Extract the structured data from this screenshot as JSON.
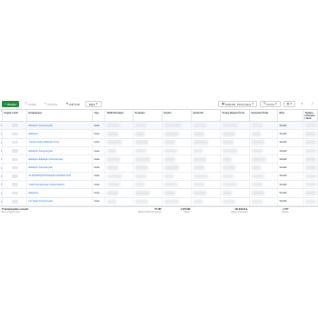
{
  "toolbar": {
    "create_label": "Oluştur",
    "duplicate_label": "Çoğalt",
    "edit_label": "Düzenle",
    "ab_test_label": "A/B Testi",
    "other_label": "Diğer",
    "columns_label": "Sütunlar: Performans",
    "breakdown_label": "Kırılım"
  },
  "columns": {
    "toggle": "Kapalı / Açık",
    "name": "Kampanyas",
    "delivery": "Yayı",
    "bid": "Teklif Stratejisi",
    "results": "Sonuçlar",
    "reach": "Erişim",
    "impressions": "Gösterim",
    "cost_per_result": "Sonuç Başına Ücret",
    "amount_spent": "Harcanan Tutar",
    "ends": "Bitiş",
    "schedule": "Toplam Harcama Limiti",
    "last": "Harcanan Tutar Limiti"
  },
  "rows": [
    {
      "name": "Etkileşim Kampanyası",
      "delivery": "Geta",
      "end": "Sürekli"
    },
    {
      "name": "Etkileşim",
      "delivery": "Geta",
      "end": "Sürekli"
    },
    {
      "name": "Yapılan Satış Etkileşim Kmp.",
      "delivery": "Geta",
      "end": "Sürekli"
    },
    {
      "name": "Etkileşim Kampanyası",
      "delivery": "Geta",
      "end": "Sürekli"
    },
    {
      "name": "Etkileşim Etkileşim Kampanyası",
      "delivery": "Geta",
      "end": "Sürekli"
    },
    {
      "name": "Etkileşim Kampanyası",
      "delivery": "Geta",
      "end": "Sürekli"
    },
    {
      "name": "ALIŞVERİŞ ETKİLEŞİM KAMPANYASI",
      "delivery": "Geta",
      "end": "Sürekli"
    },
    {
      "name": "Trafik Kampanyası (Sanal Reels)",
      "delivery": "Geta",
      "end": "Sürekli"
    },
    {
      "name": "Etkileşim",
      "delivery": "Geta",
      "end": "Sürekli"
    },
    {
      "name": "Hız Satış Kampanyası",
      "delivery": "Geta",
      "end": "Sürekli"
    }
  ],
  "totals": {
    "label": "77 kampanyadan sonuçlar",
    "sub": "Silinen öğeler hariç",
    "reach": "57.795",
    "reach_sub": "Birden Fazla Kampanya",
    "impressions": "1.478.966",
    "impressions_sub": "Toplam",
    "spent": "194.843,02 ₺",
    "spent_sub": "Toplam Harcanan",
    "last": "2.777",
    "last_sub": "Toplam"
  }
}
